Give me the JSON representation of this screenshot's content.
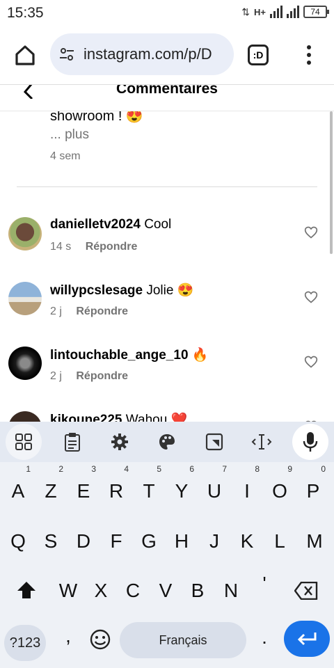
{
  "status_bar": {
    "time": "15:35",
    "network": "H+",
    "battery": "74"
  },
  "browser": {
    "url": "instagram.com/p/D",
    "tab_label": ":D"
  },
  "page": {
    "title": "Commentaires"
  },
  "previous_comment": {
    "text_tail": "showroom ! 😍",
    "more_label": "... plus",
    "time": "4 sem"
  },
  "comments": [
    {
      "username": "danielletv2024",
      "text": "Cool",
      "time": "14 s",
      "reply_label": "Répondre"
    },
    {
      "username": "willypcslesage",
      "text": "Jolie 😍",
      "time": "2 j",
      "reply_label": "Répondre"
    },
    {
      "username": "lintouchable_ange_10",
      "text": "🔥",
      "time": "2 j",
      "reply_label": "Répondre"
    },
    {
      "username": "kikoune225",
      "text": "Wahou ❤️",
      "time": "",
      "reply_label": ""
    }
  ],
  "keyboard": {
    "row1": [
      {
        "key": "A",
        "hint": "1"
      },
      {
        "key": "Z",
        "hint": "2"
      },
      {
        "key": "E",
        "hint": "3"
      },
      {
        "key": "R",
        "hint": "4"
      },
      {
        "key": "T",
        "hint": "5"
      },
      {
        "key": "Y",
        "hint": "6"
      },
      {
        "key": "U",
        "hint": "7"
      },
      {
        "key": "I",
        "hint": "8"
      },
      {
        "key": "O",
        "hint": "9"
      },
      {
        "key": "P",
        "hint": "0"
      }
    ],
    "row2": [
      "Q",
      "S",
      "D",
      "F",
      "G",
      "H",
      "J",
      "K",
      "L",
      "M"
    ],
    "row3": [
      "W",
      "X",
      "C",
      "V",
      "B",
      "N",
      "'"
    ],
    "symbols_label": "?123",
    "comma_label": ",",
    "space_label": "Français",
    "period_label": "."
  }
}
